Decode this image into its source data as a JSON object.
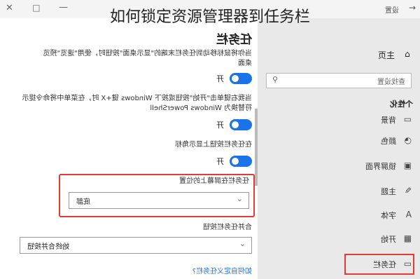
{
  "overlay": {
    "title": "如何锁定资源管理器到任务栏"
  },
  "window": {
    "settings_label": "设置",
    "back_glyph": "←",
    "minimize_glyph": "—",
    "maximize_glyph": "□",
    "close_glyph": "✕"
  },
  "sidebar": {
    "home_label": "主页",
    "home_icon": "⌂",
    "search_placeholder": "查找设置",
    "search_icon": "⚲",
    "section_title": "个性化",
    "items": [
      {
        "label": "背景",
        "icon": "▭"
      },
      {
        "label": "颜色",
        "icon": "◔"
      },
      {
        "label": "锁屏界面",
        "icon": "▣"
      },
      {
        "label": "主题",
        "icon": "✎"
      },
      {
        "label": "字体",
        "icon": "A"
      },
      {
        "label": "开始",
        "icon": "▦"
      },
      {
        "label": "任务栏",
        "icon": "▭"
      }
    ]
  },
  "content": {
    "title": "任务栏",
    "desc1": "当你将鼠标移动到任务栏末端的\"显示桌面\"按钮时，使用\"速览\"预览桌面",
    "toggle1": "开",
    "desc2": "当我右键单击\"开始\"按钮或按下 Windows 键+X 时，在菜单中将命令提示符替换为 Windows PowerShell",
    "toggle2": "开",
    "desc3": "在任务栏按钮上显示角标",
    "toggle3": "开",
    "position_label": "任务栏在屏幕上的位置",
    "position_value": "底部",
    "combine_label": "合并任务栏按钮",
    "combine_value": "始终合并按钮",
    "link": "如何自定义任务栏?"
  },
  "colors": {
    "accent": "#1a73e8",
    "highlight": "#e53935"
  }
}
